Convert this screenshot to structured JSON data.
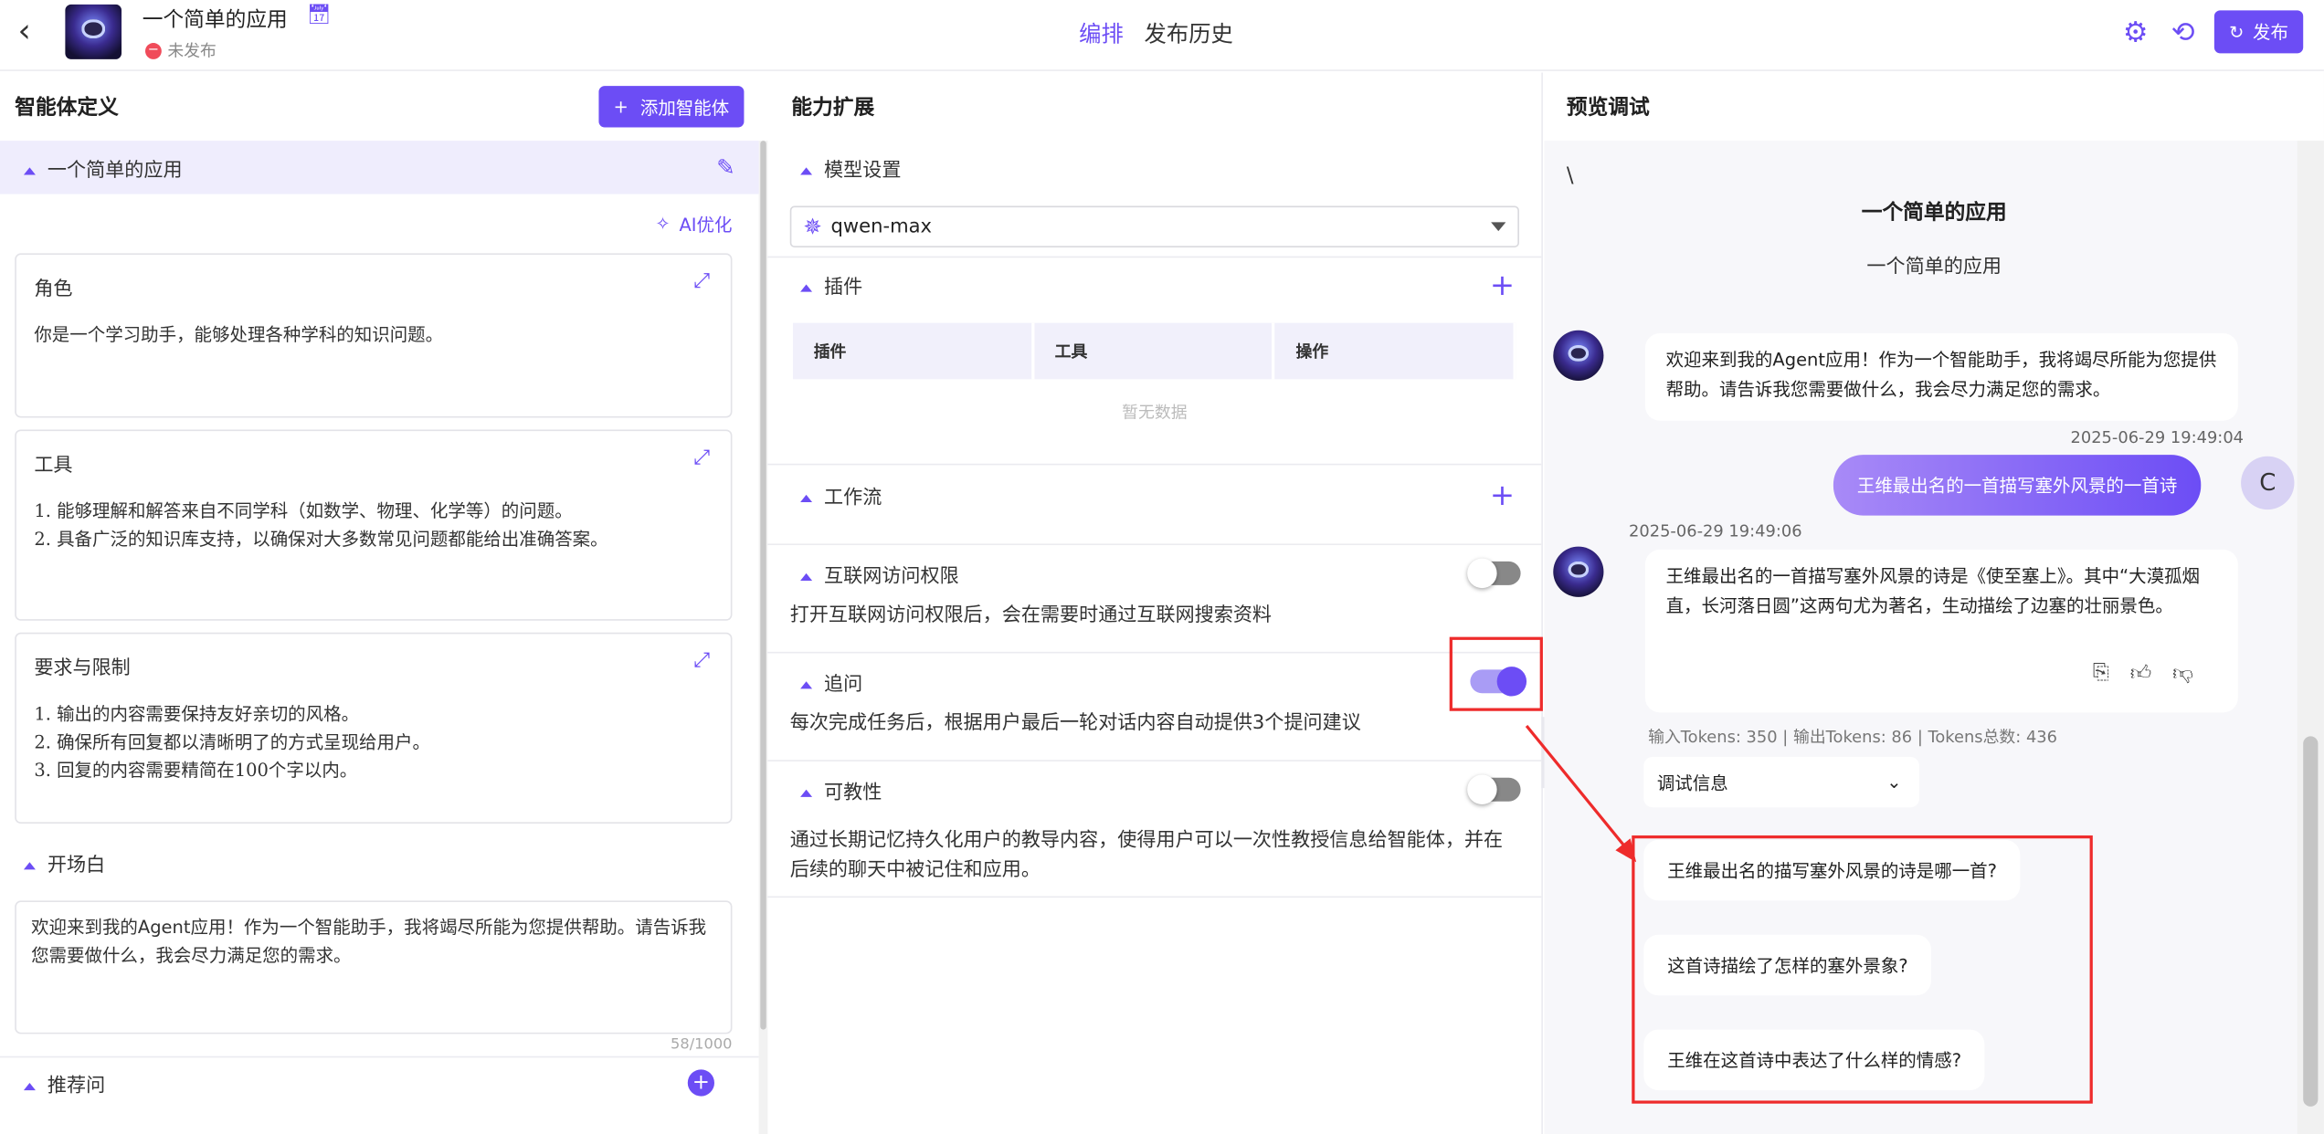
{
  "header": {
    "app_title": "一个简单的应用",
    "status": "未发布",
    "tabs": [
      "编排",
      "发布历史"
    ],
    "publish_label": "发布"
  },
  "left": {
    "heading": "智能体定义",
    "add_agent_label": "添加智能体",
    "agent_name": "一个简单的应用",
    "ai_optimize_label": "AI优化",
    "role": {
      "title": "角色",
      "text": "你是一个学习助手，能够处理各种学科的知识问题。"
    },
    "tools": {
      "title": "工具",
      "items": [
        "1.  能够理解和解答来自不同学科（如数学、物理、化学等）的问题。",
        "2.  具备广泛的知识库支持，以确保对大多数常见问题都能给出准确答案。"
      ]
    },
    "constraints": {
      "title": "要求与限制",
      "items": [
        "1.  输出的内容需要保持友好亲切的风格。",
        "2.  确保所有回复都以清晰明了的方式呈现给用户。",
        "3.  回复的内容需要精简在100个字以内。"
      ]
    },
    "opening": {
      "title": "开场白",
      "text": "欢迎来到我的Agent应用！作为一个智能助手，我将竭尽所能为您提供帮助。请告诉我您需要做什么，我会尽力满足您的需求。",
      "counter": "58/1000"
    },
    "recommended_label": "推荐问"
  },
  "middle": {
    "heading": "能力扩展",
    "model_section": "模型设置",
    "model_value": "qwen-max",
    "plugin_section": "插件",
    "plugin_columns": [
      "插件",
      "工具",
      "操作"
    ],
    "plugin_empty": "暂无数据",
    "workflow_section": "工作流",
    "internet_section": "互联网访问权限",
    "internet_desc": "打开互联网访问权限后，会在需要时通过互联网搜索资料",
    "followup_section": "追问",
    "followup_desc": "每次完成任务后，根据用户最后一轮对话内容自动提供3个提问建议",
    "teachable_section": "可教性",
    "teachable_desc": "通过长期记忆持久化用户的教导内容，使得用户可以一次性教授信息给智能体，并在后续的聊天中被记住和应用。",
    "toggles": {
      "internet": false,
      "followup": true,
      "teachable": false
    }
  },
  "right": {
    "heading": "预览调试",
    "slash": "\\",
    "chat_title": "一个简单的应用",
    "chat_subtitle": "一个简单的应用",
    "bot_welcome": "欢迎来到我的Agent应用！作为一个智能助手，我将竭尽所能为您提供帮助。请告诉我您需要做什么，我会尽力满足您的需求。",
    "user_time": "2025-06-29 19:49:04",
    "user_message": "王维最出名的一首描写塞外风景的一首诗",
    "user_avatar": "C",
    "bot_time": "2025-06-29 19:49:06",
    "bot_reply": "王维最出名的一首描写塞外风景的诗是《使至塞上》。其中“大漠孤烟直，长河落日圆”这两句尤为著名，生动描绘了边塞的壮丽景色。",
    "tokens": "输入Tokens: 350 |  输出Tokens: 86 |  Tokens总数: 436",
    "debug_label": "调试信息",
    "suggestions": [
      "王维最出名的描写塞外风景的诗是哪一首?",
      "这首诗描绘了怎样的塞外景象?",
      "王维在这首诗中表达了什么样的情感?"
    ]
  },
  "colors": {
    "accent": "#6c4df5",
    "highlight": "#ee2b2b"
  }
}
